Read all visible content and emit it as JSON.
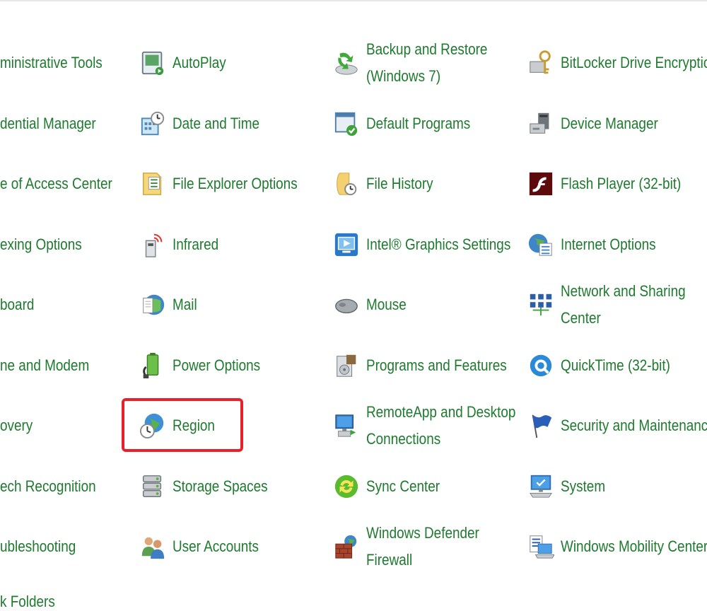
{
  "items": {
    "col0": [
      "ministrative Tools",
      "dential Manager",
      "e of Access Center",
      "exing Options",
      "board",
      "ne and Modem",
      "overy",
      "ech Recognition",
      "ubleshooting"
    ],
    "autoplay": "AutoPlay",
    "date_time": "Date and Time",
    "file_explorer_options": "File Explorer Options",
    "infrared": "Infrared",
    "mail": "Mail",
    "power_options": "Power Options",
    "region": "Region",
    "storage_spaces": "Storage Spaces",
    "user_accounts": "User Accounts",
    "backup_restore_l1": "Backup and Restore",
    "backup_restore_l2": "(Windows 7)",
    "default_programs": "Default Programs",
    "file_history": "File History",
    "intel_graphics": "Intel® Graphics Settings",
    "mouse": "Mouse",
    "programs_features": "Programs and Features",
    "remoteapp_l1": "RemoteApp and Desktop",
    "remoteapp_l2": "Connections",
    "sync_center": "Sync Center",
    "defender_l1": "Windows Defender",
    "defender_l2": "Firewall",
    "bitlocker": "BitLocker Drive Encryption",
    "device_manager": "Device Manager",
    "flash_player": "Flash Player (32-bit)",
    "internet_options": "Internet Options",
    "network_l1": "Network and Sharing",
    "network_l2": "Center",
    "quicktime": "QuickTime (32-bit)",
    "security_maintenance": "Security and Maintenance",
    "system": "System",
    "mobility_center": "Windows Mobility Center",
    "cut_off_bottom": "k Folders"
  },
  "colors": {
    "link_green": "#1e7a2e",
    "highlight_red": "#e8202a"
  }
}
